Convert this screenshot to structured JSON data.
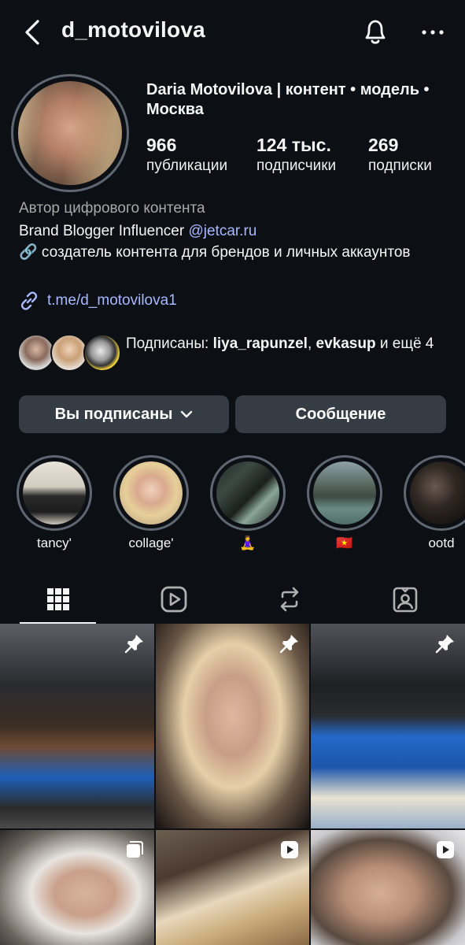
{
  "header": {
    "username": "d_motovilova"
  },
  "profile": {
    "full_name": "Daria Motovilova | контент • модель • Москва",
    "stats": [
      {
        "value": "966",
        "label": "публикации"
      },
      {
        "value": "124 тыс.",
        "label": "подписчики"
      },
      {
        "value": "269",
        "label": "подписки"
      }
    ],
    "category": "Автор цифрового контента",
    "bio_line1": "Brand Blogger Influencer ",
    "bio_mention": "@jetcar.ru",
    "bio_line2": "🔗 создатель контента для брендов и личных аккаунтов",
    "link": "t.me/d_motovilova1"
  },
  "followed_by": {
    "prefix": "Подписаны: ",
    "user1": "liya_rapunzel",
    "sep": ", ",
    "user2": "evkasup",
    "suffix": " и ещё 4"
  },
  "buttons": {
    "following": "Вы подписаны",
    "message": "Сообщение"
  },
  "highlights": [
    {
      "caption": "tancy'"
    },
    {
      "caption": "collage'"
    },
    {
      "caption": "🧘‍♀️"
    },
    {
      "caption": "🇻🇳"
    },
    {
      "caption": "ootd"
    }
  ],
  "tabs": [
    "grid-icon",
    "reels-icon",
    "reposts-icon",
    "tagged-icon"
  ],
  "colors": {
    "background": "#0c1014",
    "button": "#363c44",
    "link": "#a8b8ff",
    "secondary_text": "#a8a8a8"
  }
}
